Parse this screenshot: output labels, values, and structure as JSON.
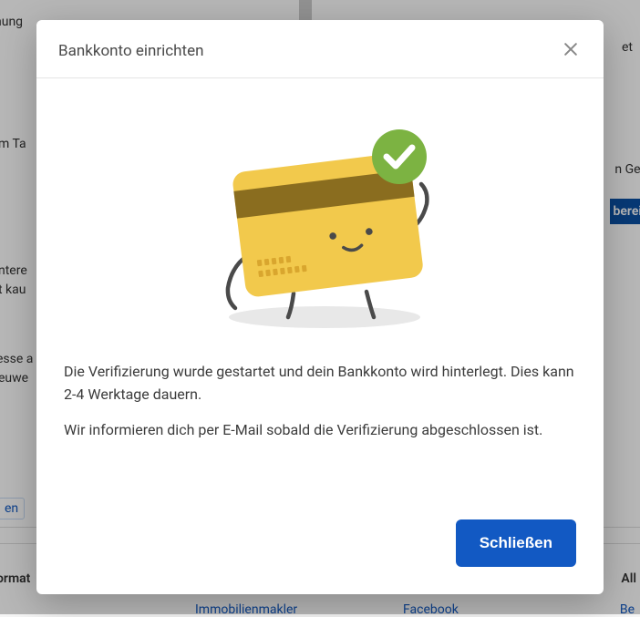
{
  "modal": {
    "title": "Bankkonto einrichten",
    "message1": "Die Verifizierung wurde gestartet und dein Bankkonto wird hinterlegt. Dies kann 2-4 Werktage dauern.",
    "message2": "Wir informieren dich per E-Mail sobald die Verifizierung abgeschlossen ist.",
    "close_button": "Schließen"
  },
  "background": {
    "frag1": "nung",
    "frag2": "m Ta",
    "frag3": "ntere",
    "frag4": "t kau",
    "frag5": "esse a",
    "frag6": "euwe",
    "frag7": "en",
    "frag8": "ormat",
    "frag9": "et",
    "frag10": "n Gel",
    "frag11": "berei",
    "frag12": "All",
    "frag13": "Be",
    "link1": "Immobilienmakler",
    "link2": "Facebook"
  }
}
